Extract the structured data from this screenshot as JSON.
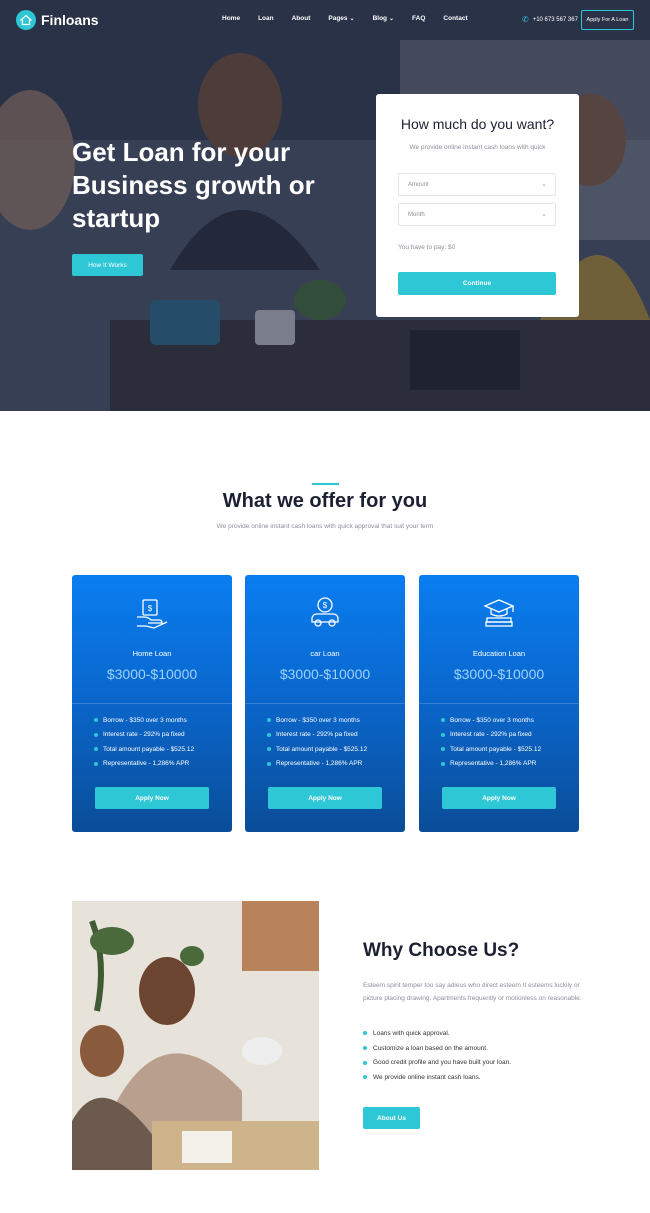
{
  "brand": {
    "name": "Finloans",
    "accent": "#2ec7d6",
    "card_blue": "#0a6fdc"
  },
  "nav": {
    "items": [
      {
        "label": "Home",
        "has_dropdown": false
      },
      {
        "label": "Loan",
        "has_dropdown": false
      },
      {
        "label": "About",
        "has_dropdown": false
      },
      {
        "label": "Pages",
        "has_dropdown": true
      },
      {
        "label": "Blog",
        "has_dropdown": true
      },
      {
        "label": "FAQ",
        "has_dropdown": false
      },
      {
        "label": "Contact",
        "has_dropdown": false
      }
    ],
    "phone": "+10 673 567 367",
    "phone_icon": "phone-icon",
    "apply_label": "Apply For A Loan"
  },
  "hero": {
    "title": "Get Loan for your Business growth or startup",
    "button": "How It Works"
  },
  "calculator": {
    "title": "How much do you want?",
    "subtitle": "We provide online instant cash loans with quick",
    "amount_placeholder": "Amount",
    "month_placeholder": "Month",
    "pay_text": "You have to pay: $0",
    "button": "Continue"
  },
  "offer": {
    "title": "What we offer for you",
    "subtitle": "We provide online instant cash loans with quick approval that suit your term",
    "cards": [
      {
        "icon": "money-hand-icon",
        "name": "Home Loan",
        "price": "$3000-$10000",
        "features": [
          "Borrow - $350 over 3 months",
          "Interest rate - 292% pa fixed",
          "Total amount payable - $525.12",
          "Representative - 1,286% APR"
        ],
        "button": "Apply Now"
      },
      {
        "icon": "car-loan-icon",
        "name": "car Loan",
        "price": "$3000-$10000",
        "features": [
          "Borrow - $350 over 3 months",
          "Interest rate - 292% pa fixed",
          "Total amount payable - $525.12",
          "Representative - 1,286% APR"
        ],
        "button": "Apply Now"
      },
      {
        "icon": "graduation-cap-icon",
        "name": "Education Loan",
        "price": "$3000-$10000",
        "features": [
          "Borrow - $350 over 3 months",
          "Interest rate - 292% pa fixed",
          "Total amount payable - $525.12",
          "Representative - 1,286% APR"
        ],
        "button": "Apply Now"
      }
    ]
  },
  "why": {
    "title": "Why Choose Us?",
    "description": "Esteem spirit temper too say adieus who direct esteem It esteems luckily or picture placing drawing. Apartments frequently or motionless on reasonable.",
    "points": [
      "Loans with quick approval.",
      "Customize a loan based on the amount.",
      "Good credit profile and you have built your loan.",
      "We provide online instant cash loans."
    ],
    "button": "About Us"
  }
}
